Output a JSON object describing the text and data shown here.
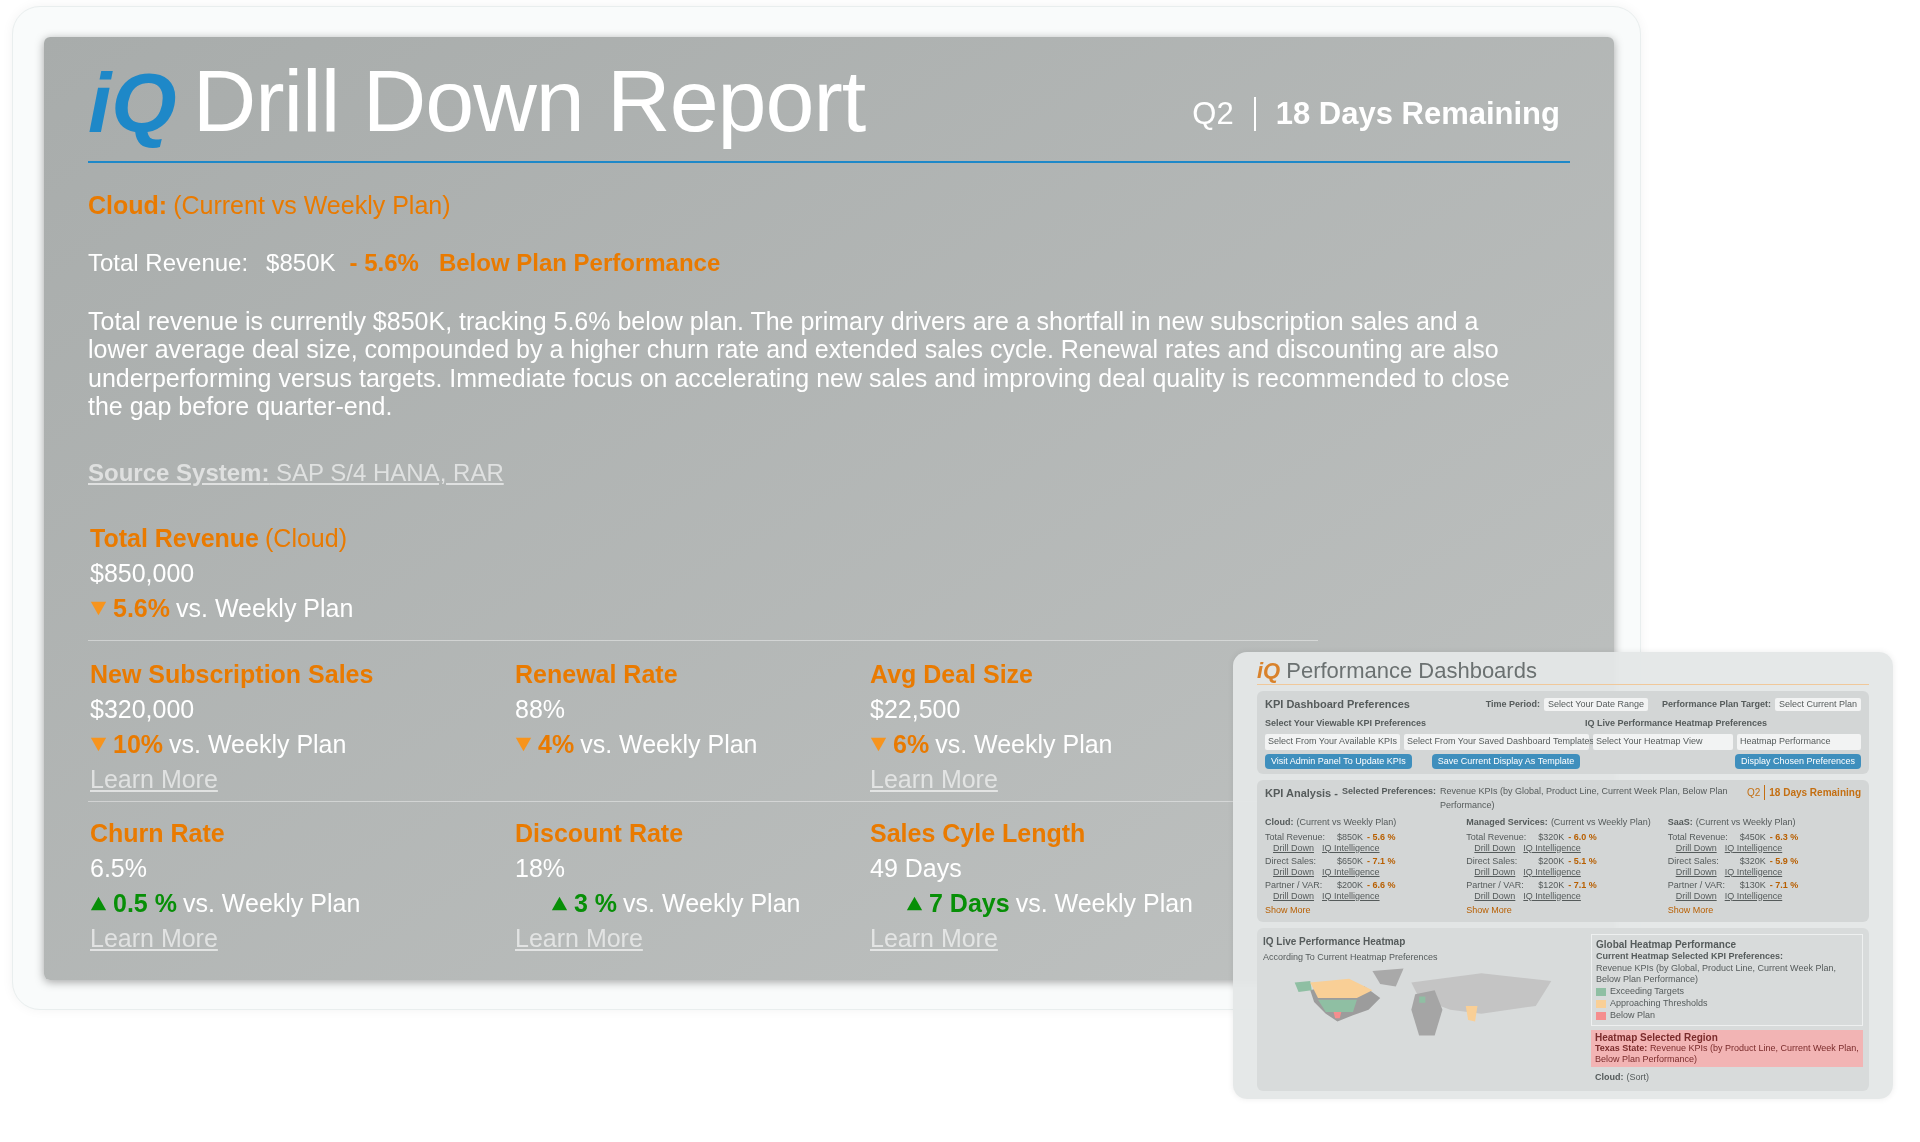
{
  "header": {
    "logo": "iQ",
    "title": "Drill Down Report",
    "quarter": "Q2",
    "remaining": "18 Days Remaining"
  },
  "summary": {
    "segment": "Cloud:",
    "segment_note": "(Current vs Weekly Plan)",
    "revenue_label": "Total Revenue:",
    "revenue_value": "$850K",
    "change": "- 5.6%",
    "status": "Below Plan Performance",
    "paragraph": "Total revenue is currently $850K, tracking 5.6% below plan. The primary drivers are a shortfall in new subscription sales and a lower average deal size, compounded by a higher churn rate and extended sales cycle. Renewal rates and discounting are also underperforming versus targets. Immediate focus on accelerating new sales and improving deal quality is recommended to close the gap before quarter-end.",
    "source_label": "Source System:",
    "source_value": "SAP S/4 HANA, RAR"
  },
  "total": {
    "title": "Total Revenue",
    "note": "(Cloud)",
    "value": "$850,000",
    "kind": "decrease",
    "change": "5.6%",
    "suffix": "vs. Weekly Plan"
  },
  "metrics": [
    {
      "title": "New Subscription Sales",
      "value": "$320,000",
      "kind": "decrease",
      "change": "10%",
      "suffix": "vs. Weekly Plan",
      "link": "Learn More"
    },
    {
      "title": "Renewal Rate",
      "value": "88%",
      "kind": "decrease",
      "change": "4%",
      "suffix": "vs. Weekly Plan"
    },
    {
      "title": "Avg Deal Size",
      "value": "$22,500",
      "kind": "decrease",
      "change": "6%",
      "suffix": "vs. Weekly Plan",
      "link": "Learn More"
    },
    {
      "title": "Churn Rate",
      "value": "6.5%",
      "kind": "increase",
      "change": "0.5 %",
      "suffix": "vs. Weekly Plan",
      "link": "Learn More"
    },
    {
      "title": "Discount Rate",
      "value": "18%",
      "kind": "increase",
      "change": "3 %",
      "suffix": "vs. Weekly Plan",
      "link": "Learn More"
    },
    {
      "title": "Sales Cyle Length",
      "value": "49 Days",
      "kind": "increase",
      "change": "7 Days",
      "suffix": "vs. Weekly Plan",
      "link": "Learn More"
    }
  ],
  "preview": {
    "logo": "iQ",
    "title": "Performance Dashboards",
    "preferences": {
      "title": "KPI Dashboard Preferences",
      "time_label": "Time Period:",
      "time_value": "Select Your Date Range",
      "target_label": "Performance Plan Target:",
      "target_value": "Select Current Plan",
      "kpi_label": "Select Your Viewable KPI Preferences",
      "heatmap_label": "IQ Live Performance Heatmap Preferences",
      "selects": [
        "Select From Your Available KPIs",
        "Select From Your Saved Dashboard Templates",
        "Select Your Heatmap View",
        "Heatmap Performance"
      ],
      "buttons": [
        "Visit Admin Panel To Update KPIs",
        "Save Current Display As Template",
        "Display Chosen Preferences"
      ]
    },
    "analysis": {
      "title": "KPI Analysis -",
      "prefs_label": "Selected Preferences:",
      "prefs": "Revenue KPIs (by Global, Product Line, Current Week Plan, Below Plan Performance)",
      "quarter": "Q2",
      "remaining": "18 Days Remaining",
      "segments": [
        {
          "name": "Cloud:",
          "note": "(Current vs Weekly Plan)",
          "rows": [
            {
              "label": "Total Revenue:",
              "value": "$850K",
              "change": "- 5.6 %",
              "drill": "Drill Down",
              "intel": "IQ Intelligence"
            },
            {
              "label": "Direct Sales:",
              "value": "$650K",
              "change": "- 7.1 %",
              "drill": "Drill Down",
              "intel": "IQ Intelligence"
            },
            {
              "label": "Partner / VAR:",
              "value": "$200K",
              "change": "- 6.6 %",
              "drill": "Drill Down",
              "intel": "IQ Intelligence"
            }
          ],
          "show_more": "Show More"
        },
        {
          "name": "Managed Services:",
          "note": "(Current vs Weekly Plan)",
          "rows": [
            {
              "label": "Total Revenue:",
              "value": "$320K",
              "change": "- 6.0 %",
              "drill": "Drill Down",
              "intel": "IQ Intelligence"
            },
            {
              "label": "Direct Sales:",
              "value": "$200K",
              "change": "- 5.1 %",
              "drill": "Drill Down",
              "intel": "IQ Intelligence"
            },
            {
              "label": "Partner / VAR:",
              "value": "$120K",
              "change": "- 7.1 %",
              "drill": "Drill Down",
              "intel": "IQ Intelligence"
            }
          ],
          "show_more": "Show More"
        },
        {
          "name": "SaaS:",
          "note": "(Current vs Weekly Plan)",
          "rows": [
            {
              "label": "Total Revenue:",
              "value": "$450K",
              "change": "- 6.3 %",
              "drill": "Drill Down",
              "intel": "IQ Intelligence"
            },
            {
              "label": "Direct Sales:",
              "value": "$320K",
              "change": "- 5.9 %",
              "drill": "Drill Down",
              "intel": "IQ Intelligence"
            },
            {
              "label": "Partner / VAR:",
              "value": "$130K",
              "change": "- 7.1 %",
              "drill": "Drill Down",
              "intel": "IQ Intelligence"
            }
          ],
          "show_more": "Show More"
        }
      ]
    },
    "heatmap": {
      "title": "IQ Live Performance Heatmap",
      "subtitle": "According To Current Heatmap Preferences",
      "legend_title": "Global Heatmap Performance",
      "legend_subtitle": "Current Heatmap Selected KPI Preferences:",
      "legend_prefs": "Revenue KPIs (by Global, Product Line, Current Week Plan, Below Plan Performance)",
      "legend": [
        {
          "label": "Exceeding Targets",
          "color": "#8fbfa3"
        },
        {
          "label": "Approaching Thresholds",
          "color": "#f9cf96"
        },
        {
          "label": "Below Plan",
          "color": "#f58e8e"
        }
      ],
      "region_title": "Heatmap Selected Region",
      "region_label": "Texas State:",
      "region_text": "Revenue KPIs (by Product Line, Current Week Plan, Below Plan Performance)",
      "cloud": "Cloud:",
      "cloud_note": "(Sort)"
    }
  }
}
